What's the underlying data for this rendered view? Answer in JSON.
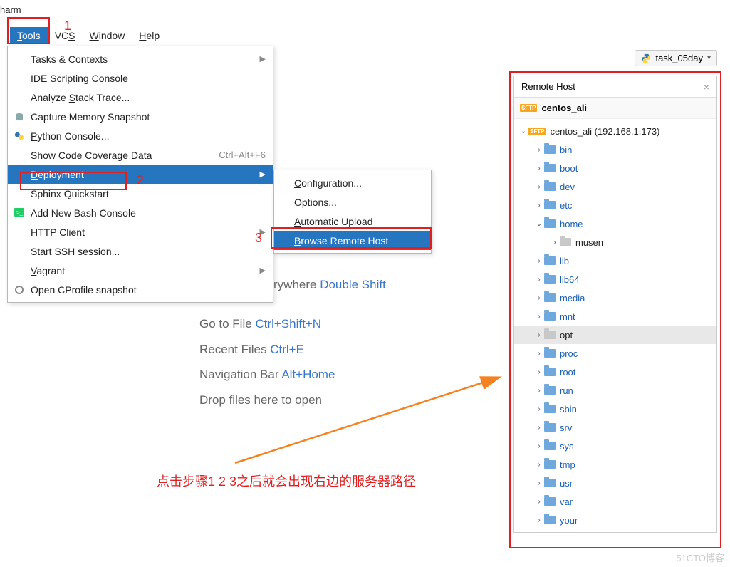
{
  "title_fragment": "harm",
  "menubar": {
    "tools": "Tools",
    "vcs": "VCS",
    "window": "Window",
    "help": "Help"
  },
  "run_config": "task_05day",
  "tools_menu": [
    {
      "label": "Tasks & Contexts",
      "arrow": true
    },
    {
      "label": "IDE Scripting Console"
    },
    {
      "label": "Analyze Stack Trace...",
      "underline": "S"
    },
    {
      "label": "Capture Memory Snapshot",
      "icon": "db"
    },
    {
      "label": "Python Console...",
      "icon": "py",
      "underline": "P"
    },
    {
      "label": "Show Code Coverage Data",
      "shortcut": "Ctrl+Alt+F6",
      "underline": "C"
    },
    {
      "label": "Deployment",
      "arrow": true,
      "highlighted": true,
      "underline": "D"
    },
    {
      "label": "Sphinx Quickstart"
    },
    {
      "label": "Add New Bash Console",
      "icon": "term"
    },
    {
      "label": "HTTP Client",
      "arrow": true
    },
    {
      "label": "Start SSH session..."
    },
    {
      "label": "Vagrant",
      "arrow": true,
      "underline": "V"
    },
    {
      "label": "Open CProfile snapshot",
      "icon": "prof"
    }
  ],
  "deployment_submenu": [
    {
      "label": "Configuration...",
      "underline": "C"
    },
    {
      "label": "Options...",
      "underline": "O"
    },
    {
      "label": "Automatic Upload",
      "underline": "A"
    },
    {
      "label": "Browse Remote Host",
      "highlighted": true,
      "underline": "B"
    }
  ],
  "welcome": {
    "partial": "rywhere",
    "shortcut1": "Double Shift",
    "line2_label": "Go to File",
    "line2_kb": "Ctrl+Shift+N",
    "line3_label": "Recent Files",
    "line3_kb": "Ctrl+E",
    "line4_label": "Navigation Bar",
    "line4_kb": "Alt+Home",
    "line5": "Drop files here to open"
  },
  "remote": {
    "tab": "Remote Host",
    "server": "centos_ali",
    "root": "centos_ali (192.168.1.173)",
    "folders": [
      {
        "name": "bin",
        "d": 1
      },
      {
        "name": "boot",
        "d": 1
      },
      {
        "name": "dev",
        "d": 1
      },
      {
        "name": "etc",
        "d": 1
      },
      {
        "name": "home",
        "d": 1,
        "open": true
      },
      {
        "name": "musen",
        "d": 2,
        "grey": true
      },
      {
        "name": "lib",
        "d": 1
      },
      {
        "name": "lib64",
        "d": 1
      },
      {
        "name": "media",
        "d": 1
      },
      {
        "name": "mnt",
        "d": 1
      },
      {
        "name": "opt",
        "d": 1,
        "grey": true,
        "sel": true
      },
      {
        "name": "proc",
        "d": 1
      },
      {
        "name": "root",
        "d": 1
      },
      {
        "name": "run",
        "d": 1
      },
      {
        "name": "sbin",
        "d": 1
      },
      {
        "name": "srv",
        "d": 1
      },
      {
        "name": "sys",
        "d": 1
      },
      {
        "name": "tmp",
        "d": 1
      },
      {
        "name": "usr",
        "d": 1
      },
      {
        "name": "var",
        "d": 1
      },
      {
        "name": "your",
        "d": 1
      }
    ]
  },
  "annotations": {
    "n1": "1",
    "n2": "2",
    "n3": "3",
    "caption": "点击步骤1 2 3之后就会出现右边的服务器路径"
  },
  "watermark": "51CTO博客"
}
